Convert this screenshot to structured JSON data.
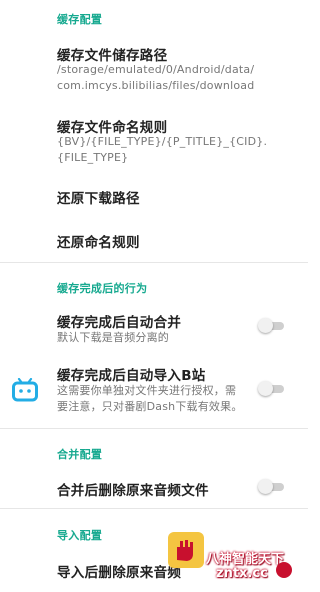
{
  "sections": {
    "cache_config": "缓存配置",
    "after_cache": "缓存完成后的行为",
    "merge_config": "合并配置",
    "import_config": "导入配置"
  },
  "items": {
    "storage_path": {
      "title": "缓存文件储存路径",
      "value_line1": "/storage/emulated/0/Android/data/",
      "value_line2": "com.imcys.bilibilias/files/download"
    },
    "naming_rule": {
      "title": "缓存文件命名规则",
      "value_line1": "{BV}/{FILE_TYPE}/{P_TITLE}_{CID}.",
      "value_line2": "{FILE_TYPE}"
    },
    "restore_path": {
      "title": "还原下载路径"
    },
    "restore_naming": {
      "title": "还原命名规则"
    },
    "auto_merge": {
      "title": "缓存完成后自动合并",
      "subtitle": "默认下载是音频分离的",
      "enabled": false
    },
    "auto_import": {
      "title": "缓存完成后自动导入B站",
      "subtitle_line1": "这需要你单独对文件夹进行授权，需",
      "subtitle_line2": "要注意，只对番剧Dash下载有效果。",
      "enabled": false
    },
    "delete_audio_after_merge": {
      "title": "合并后删除原来音频文件",
      "enabled": false
    },
    "delete_after_import": {
      "title": "导入后删除原来音频"
    }
  },
  "icons": {
    "bilibili": "bilibili-tv-icon"
  },
  "colors": {
    "accent": "#16a98f",
    "bilibili_blue": "#23ade5"
  },
  "watermark": {
    "text": "八神智能天下",
    "url": "zntx.cc"
  }
}
